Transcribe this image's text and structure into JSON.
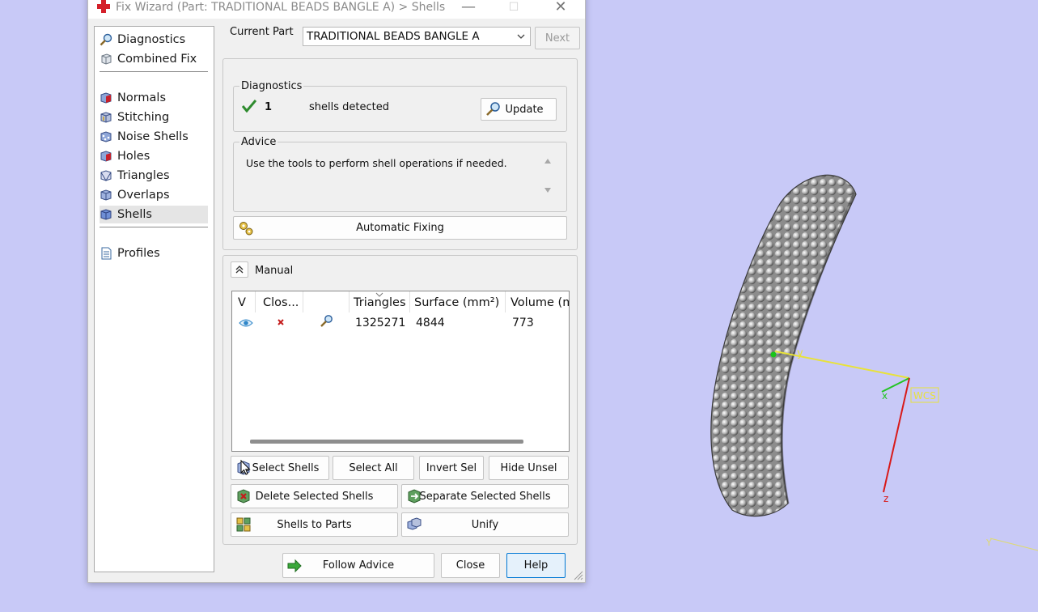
{
  "dialog": {
    "title": "Fix Wizard (Part: TRADITIONAL BEADS BANGLE A) > Shells",
    "window_controls": {
      "minimize": "—",
      "maximize": "☐",
      "close": "✕"
    }
  },
  "sidebar": {
    "items": [
      {
        "label": "Diagnostics",
        "icon": "magnifier-icon"
      },
      {
        "label": "Combined Fix",
        "icon": "cube-icon"
      },
      {
        "label": "Normals",
        "icon": "normals-cube-icon"
      },
      {
        "label": "Stitching",
        "icon": "stitching-cube-icon"
      },
      {
        "label": "Noise Shells",
        "icon": "noise-shells-icon"
      },
      {
        "label": "Holes",
        "icon": "holes-cube-icon"
      },
      {
        "label": "Triangles",
        "icon": "triangles-cube-icon"
      },
      {
        "label": "Overlaps",
        "icon": "overlaps-cube-icon"
      },
      {
        "label": "Shells",
        "icon": "shells-cube-icon",
        "selected": true
      },
      {
        "label": "Profiles",
        "icon": "document-icon"
      }
    ]
  },
  "header": {
    "current_part_label": "Current Part",
    "current_part_value": "TRADITIONAL BEADS BANGLE A",
    "next_label": "Next"
  },
  "diagnostics": {
    "title": "Diagnostics",
    "count": "1",
    "status_text": "shells detected",
    "update_label": "Update"
  },
  "advice": {
    "title": "Advice",
    "text": "Use the tools to perform shell operations if needed.",
    "auto_fix_label": "Automatic Fixing"
  },
  "manual": {
    "title": "Manual",
    "columns": [
      "V",
      "Clos...",
      "",
      "Triangles",
      "Surface (mm²)",
      "Volume (m"
    ],
    "rows": [
      {
        "triangles": "1325271",
        "surface": "4844",
        "volume": "773"
      }
    ],
    "buttons": {
      "select_shells": "Select Shells",
      "select_all": "Select All",
      "invert_sel": "Invert Sel",
      "hide_unsel": "Hide Unsel",
      "delete_selected": "Delete Selected Shells",
      "separate_selected": "Separate Selected Shells",
      "shells_to_parts": "Shells to Parts",
      "unify": "Unify"
    }
  },
  "footer": {
    "follow_advice": "Follow Advice",
    "close": "Close",
    "help": "Help"
  },
  "viewport": {
    "axis_y": "y",
    "axis_x": "x",
    "axis_z": "z",
    "wcs_label": "WCS",
    "background": "#c8c9f7"
  }
}
